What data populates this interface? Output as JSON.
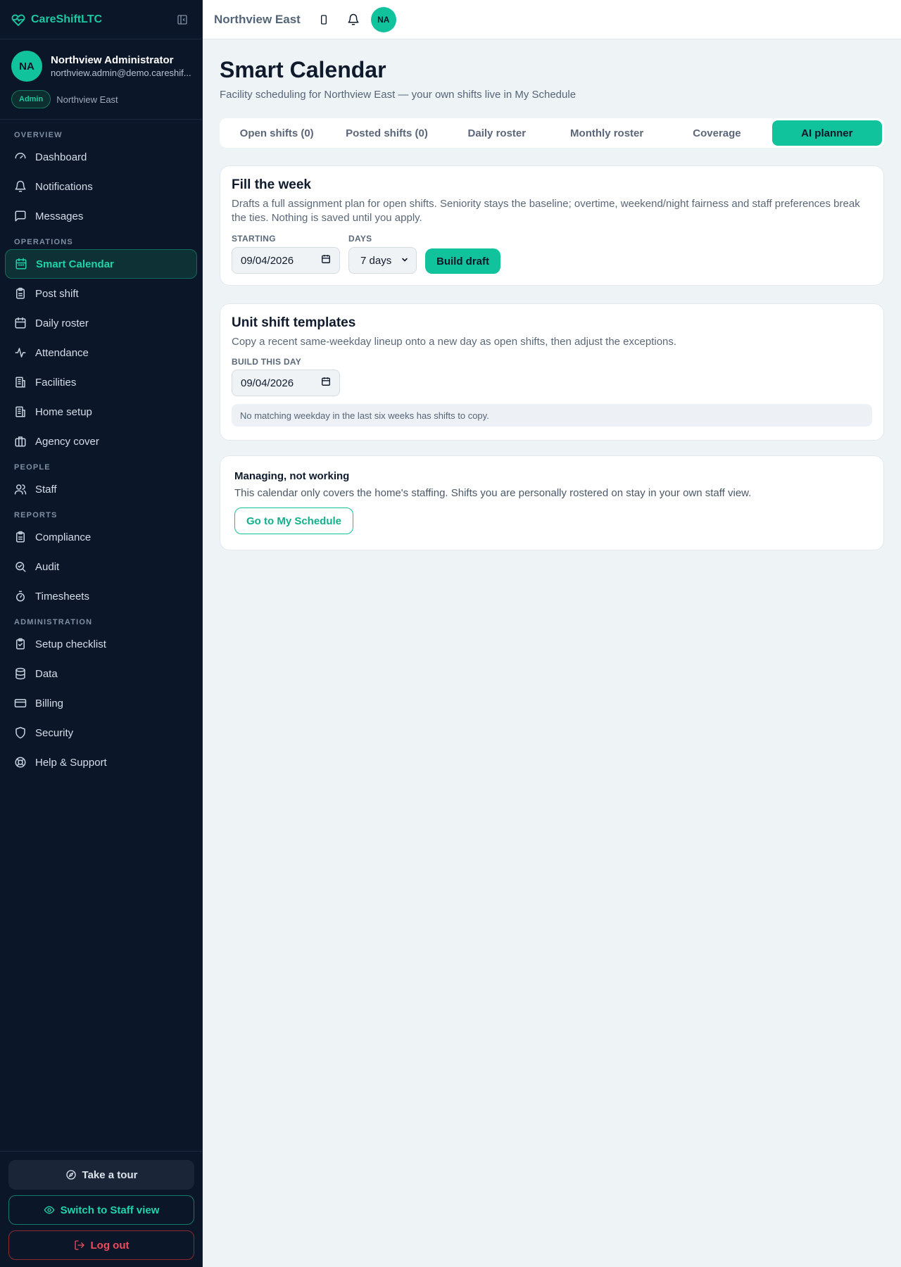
{
  "app": {
    "brand": "CareShiftLTC"
  },
  "user": {
    "initials": "NA",
    "name": "Northview Administrator",
    "email": "northview.admin@demo.careshif...",
    "role": "Admin",
    "facility": "Northview East"
  },
  "sidebar": {
    "sections": {
      "overview": "OVERVIEW",
      "operations": "OPERATIONS",
      "people": "PEOPLE",
      "reports": "REPORTS",
      "administration": "ADMINISTRATION"
    },
    "items": {
      "dashboard": "Dashboard",
      "notifications": "Notifications",
      "messages": "Messages",
      "smart_calendar": "Smart Calendar",
      "post_shift": "Post shift",
      "daily_roster": "Daily roster",
      "attendance": "Attendance",
      "facilities": "Facilities",
      "home_setup": "Home setup",
      "agency_cover": "Agency cover",
      "staff": "Staff",
      "compliance": "Compliance",
      "audit": "Audit",
      "timesheets": "Timesheets",
      "setup_checklist": "Setup checklist",
      "data": "Data",
      "billing": "Billing",
      "security": "Security",
      "help_support": "Help & Support"
    },
    "active": "smart_calendar",
    "footer": {
      "tour": "Take a tour",
      "switch_view": "Switch to Staff view",
      "logout": "Log out"
    }
  },
  "topbar": {
    "facility": "Northview East",
    "avatar": "NA"
  },
  "page": {
    "title": "Smart Calendar",
    "subtitle": "Facility scheduling for Northview East — your own shifts live in My Schedule"
  },
  "tabs": {
    "open_shifts": "Open shifts (0)",
    "posted_shifts": "Posted shifts (0)",
    "daily_roster": "Daily roster",
    "monthly_roster": "Monthly roster",
    "coverage": "Coverage",
    "ai_planner": "AI planner",
    "active": "ai_planner"
  },
  "fill_week": {
    "title": "Fill the week",
    "description": "Drafts a full assignment plan for open shifts. Seniority stays the baseline; overtime, weekend/night fairness and staff preferences break the ties. Nothing is saved until you apply.",
    "starting_label": "STARTING",
    "starting_value": "09/04/2026",
    "days_label": "DAYS",
    "days_value": "7 days",
    "build_button": "Build draft"
  },
  "templates": {
    "title": "Unit shift templates",
    "description": "Copy a recent same-weekday lineup onto a new day as open shifts, then adjust the exceptions.",
    "day_label": "BUILD THIS DAY",
    "day_value": "09/04/2026",
    "note": "No matching weekday in the last six weeks has shifts to copy."
  },
  "managing": {
    "title": "Managing, not working",
    "description": "This calendar only covers the home's staffing. Shifts you are personally rostered on stay in your own staff view.",
    "button": "Go to My Schedule"
  },
  "colors": {
    "accent": "#10c39c",
    "sidebar_bg": "#0b1628",
    "danger": "#ef4b5a"
  }
}
